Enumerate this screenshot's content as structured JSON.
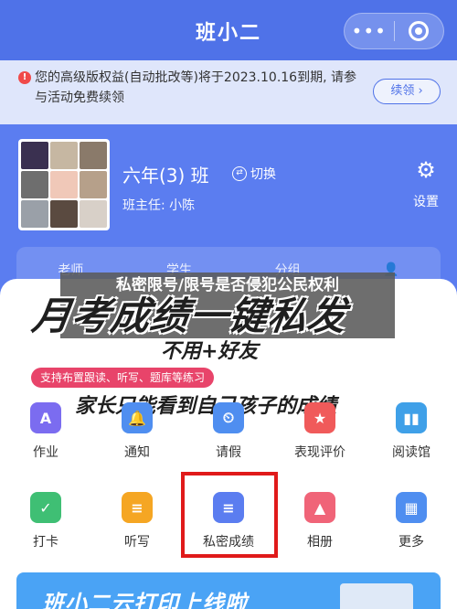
{
  "app": {
    "title": "班小二"
  },
  "capsule": {
    "more_label": "•••"
  },
  "notice": {
    "icon_glyph": "!",
    "text": "您的高级版权益(自动批改等)将于2023.10.16到期, 请参与活动免费续领",
    "renew_label": "续领 ›"
  },
  "class_info": {
    "name": "六年(3) 班",
    "switch_label": "切换",
    "teacher": "班主任: 小陈",
    "settings_label": "设置"
  },
  "tabs": [
    {
      "label": "老师"
    },
    {
      "label": "学生"
    },
    {
      "label": "分组"
    },
    {
      "label": ""
    }
  ],
  "overlay": {
    "headline": "私密限号/限号是否侵犯公民权利",
    "slogan_main": "月考成绩一键私发",
    "slogan_sub": "不用+好友",
    "tag": "支持布置跟读、听写、题库等练习",
    "slogan_parent": "家长只能看到自己孩子的成绩"
  },
  "grid": {
    "row1": [
      {
        "label": "作业",
        "icon": "homework-icon",
        "color": "#7b6cf0",
        "glyph": "A"
      },
      {
        "label": "通知",
        "icon": "bell-icon",
        "color": "#4f8ef0",
        "glyph": "🔔"
      },
      {
        "label": "请假",
        "icon": "calendar-icon",
        "color": "#4f8ef0",
        "glyph": "⏲"
      },
      {
        "label": "表现评价",
        "icon": "evaluation-icon",
        "color": "#f05a5a",
        "glyph": "★"
      },
      {
        "label": "阅读馆",
        "icon": "books-icon",
        "color": "#3fa0e8",
        "glyph": "▮▮"
      }
    ],
    "row2": [
      {
        "label": "打卡",
        "icon": "checkin-icon",
        "color": "#3fbf74",
        "glyph": "✓"
      },
      {
        "label": "听写",
        "icon": "dictation-icon",
        "color": "#f5a623",
        "glyph": "≡"
      },
      {
        "label": "私密成绩",
        "icon": "private-score-icon",
        "color": "#5b7df0",
        "glyph": "≡"
      },
      {
        "label": "相册",
        "icon": "album-icon",
        "color": "#f06478",
        "glyph": "▲"
      },
      {
        "label": "更多",
        "icon": "more-grid-icon",
        "color": "#4f8ef0",
        "glyph": "▦"
      }
    ]
  },
  "promo": {
    "text": "班小二云打印上线啦"
  }
}
